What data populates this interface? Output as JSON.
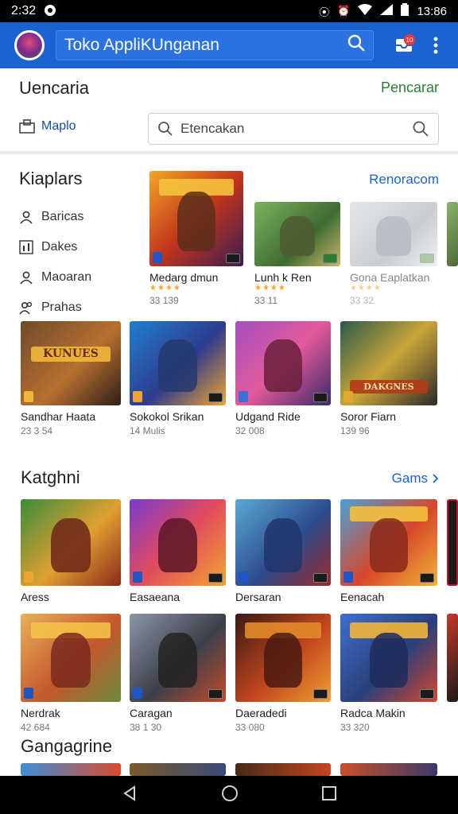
{
  "status_bar": {
    "time": "2:32",
    "clock_right": "13:86"
  },
  "app_bar": {
    "title": "Toko AppliKUnganan"
  },
  "header": {
    "title": "Uencaria",
    "link": "Pencarar",
    "tab_label": "Maplo",
    "search_placeholder": "Etencakan"
  },
  "top_section": {
    "title": "Kiaplars",
    "link": "Renoracom",
    "categories": [
      {
        "label": "Baricas",
        "icon": "person-icon"
      },
      {
        "label": "Dakes",
        "icon": "bar-chart-icon"
      },
      {
        "label": "Maoaran",
        "icon": "person-icon"
      },
      {
        "label": "Prahas",
        "icon": "people-icon"
      }
    ],
    "featured": [
      {
        "name": "Medarg dmun",
        "meta": "33 139",
        "stars": "★★★★"
      },
      {
        "name": "Lunh k Ren",
        "meta": "33 11",
        "stars": "★★★★"
      },
      {
        "name": "Gona Eaplatkan",
        "meta": "33 32",
        "stars": "★★★★"
      }
    ],
    "row2": [
      {
        "name": "Sandhar Haata",
        "meta": "23 3 54",
        "banner_text": "KUNUES"
      },
      {
        "name": "Sokokol Srikan",
        "meta": "14 Mulis"
      },
      {
        "name": "Udgand Ride",
        "meta": "32 008"
      },
      {
        "name": "Soror Fiarn",
        "meta": "139 96",
        "banner_text": "DAKGNES"
      }
    ]
  },
  "kategori": {
    "title": "Katghni",
    "link": "Gams",
    "row1": [
      {
        "name": "Aress"
      },
      {
        "name": "Easaeana"
      },
      {
        "name": "Dersaran"
      },
      {
        "name": "Eenacah"
      }
    ],
    "row2": [
      {
        "name": "Nerdrak",
        "meta": "42 684"
      },
      {
        "name": "Caragan",
        "meta": "38 1 30"
      },
      {
        "name": "Daeradedi",
        "meta": "33 080"
      },
      {
        "name": "Radca Makin",
        "meta": "33 320"
      }
    ]
  },
  "bottom_section": {
    "title": "Gangagrine"
  },
  "colors": {
    "primary": "#1a63d1",
    "accent_green": "#2e7d32",
    "star": "#f5a623"
  }
}
